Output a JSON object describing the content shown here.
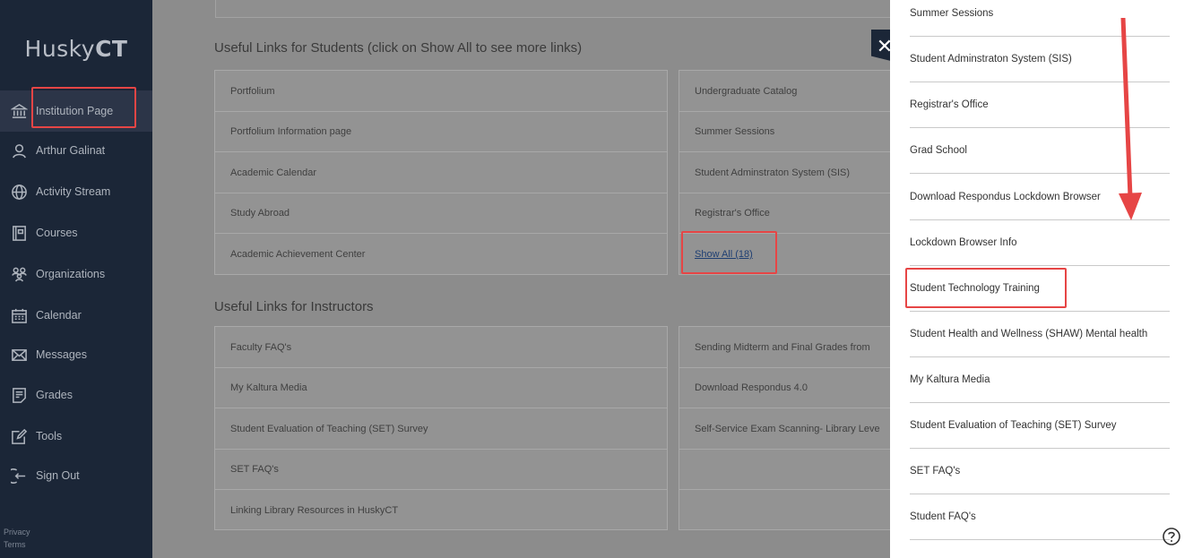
{
  "sidebar": {
    "brand_light": "Husky",
    "brand_bold": "CT",
    "items": [
      {
        "label": "Institution Page",
        "icon": "institution-icon"
      },
      {
        "label": "Arthur Galinat",
        "icon": "user-icon"
      },
      {
        "label": "Activity Stream",
        "icon": "globe-icon"
      },
      {
        "label": "Courses",
        "icon": "courses-icon"
      },
      {
        "label": "Organizations",
        "icon": "organizations-icon"
      },
      {
        "label": "Calendar",
        "icon": "calendar-icon"
      },
      {
        "label": "Messages",
        "icon": "envelope-icon"
      },
      {
        "label": "Grades",
        "icon": "grades-icon"
      },
      {
        "label": "Tools",
        "icon": "tools-icon"
      },
      {
        "label": "Sign Out",
        "icon": "sign-out-icon"
      }
    ],
    "footer": {
      "privacy": "Privacy",
      "terms": "Terms"
    }
  },
  "students_section": {
    "heading": "Useful Links for Students (click on Show All to see more links)",
    "left_links": [
      "Portfolium",
      "Portfolium Information page",
      "Academic Calendar",
      "Study Abroad",
      "Academic Achievement Center"
    ],
    "right_links": [
      "Undergraduate Catalog",
      "Summer Sessions",
      "Student Adminstraton System (SIS)",
      "Registrar's Office"
    ],
    "show_all": "Show All (18)"
  },
  "instructors_section": {
    "heading": "Useful Links for Instructors",
    "left_links": [
      "Faculty FAQ's",
      "My Kaltura Media",
      "Student Evaluation of Teaching (SET) Survey",
      "SET FAQ's",
      "Linking Library Resources in HuskyCT"
    ],
    "right_links": [
      "Sending Midterm and Final Grades from",
      "Download Respondus 4.0",
      "Self-Service Exam Scanning- Library Leve",
      ""
    ]
  },
  "close_button": "✕",
  "panel": {
    "items": [
      "Summer Sessions",
      "Student Adminstraton System (SIS)",
      "Registrar's Office",
      "Grad School",
      "Download Respondus Lockdown Browser",
      "Lockdown Browser Info",
      "Student Technology Training",
      "Student Health and Wellness (SHAW) Mental health",
      "My Kaltura Media",
      "Student Evaluation of Teaching (SET) Survey",
      "SET FAQ's",
      "Student FAQ's"
    ]
  },
  "colors": {
    "sidebar": "#1b2637",
    "highlight": "#e64545",
    "overlay": "#8c8c8c"
  }
}
